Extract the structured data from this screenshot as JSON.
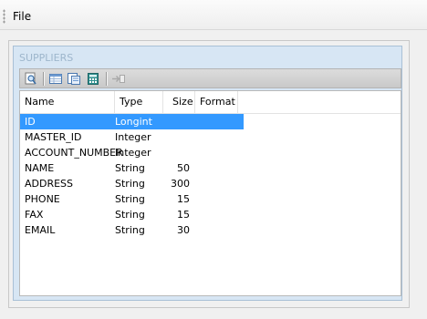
{
  "menu": {
    "file_label": "File"
  },
  "panel": {
    "title": "SUPPLIERS"
  },
  "toolbar": {
    "buttons": [
      {
        "icon": "preview-icon"
      },
      {
        "icon": "table-view-icon"
      },
      {
        "icon": "form-view-icon"
      },
      {
        "icon": "calculator-icon"
      },
      {
        "icon": "goto-field-icon"
      }
    ]
  },
  "grid": {
    "columns": [
      "Name",
      "Type",
      "Size",
      "Format"
    ],
    "selected_index": 0,
    "rows": [
      {
        "name": "ID",
        "type": "Longint",
        "size": "",
        "format": ""
      },
      {
        "name": "MASTER_ID",
        "type": "Integer",
        "size": "",
        "format": ""
      },
      {
        "name": "ACCOUNT_NUMBER",
        "type": "Integer",
        "size": "",
        "format": ""
      },
      {
        "name": "NAME",
        "type": "String",
        "size": "50",
        "format": ""
      },
      {
        "name": "ADDRESS",
        "type": "String",
        "size": "300",
        "format": ""
      },
      {
        "name": "PHONE",
        "type": "String",
        "size": "15",
        "format": ""
      },
      {
        "name": "FAX",
        "type": "String",
        "size": "15",
        "format": ""
      },
      {
        "name": "EMAIL",
        "type": "String",
        "size": "30",
        "format": ""
      }
    ]
  },
  "colors": {
    "panel_bg": "#d7e6f4",
    "selection": "#3399ff",
    "title": "#9eb6cc"
  }
}
